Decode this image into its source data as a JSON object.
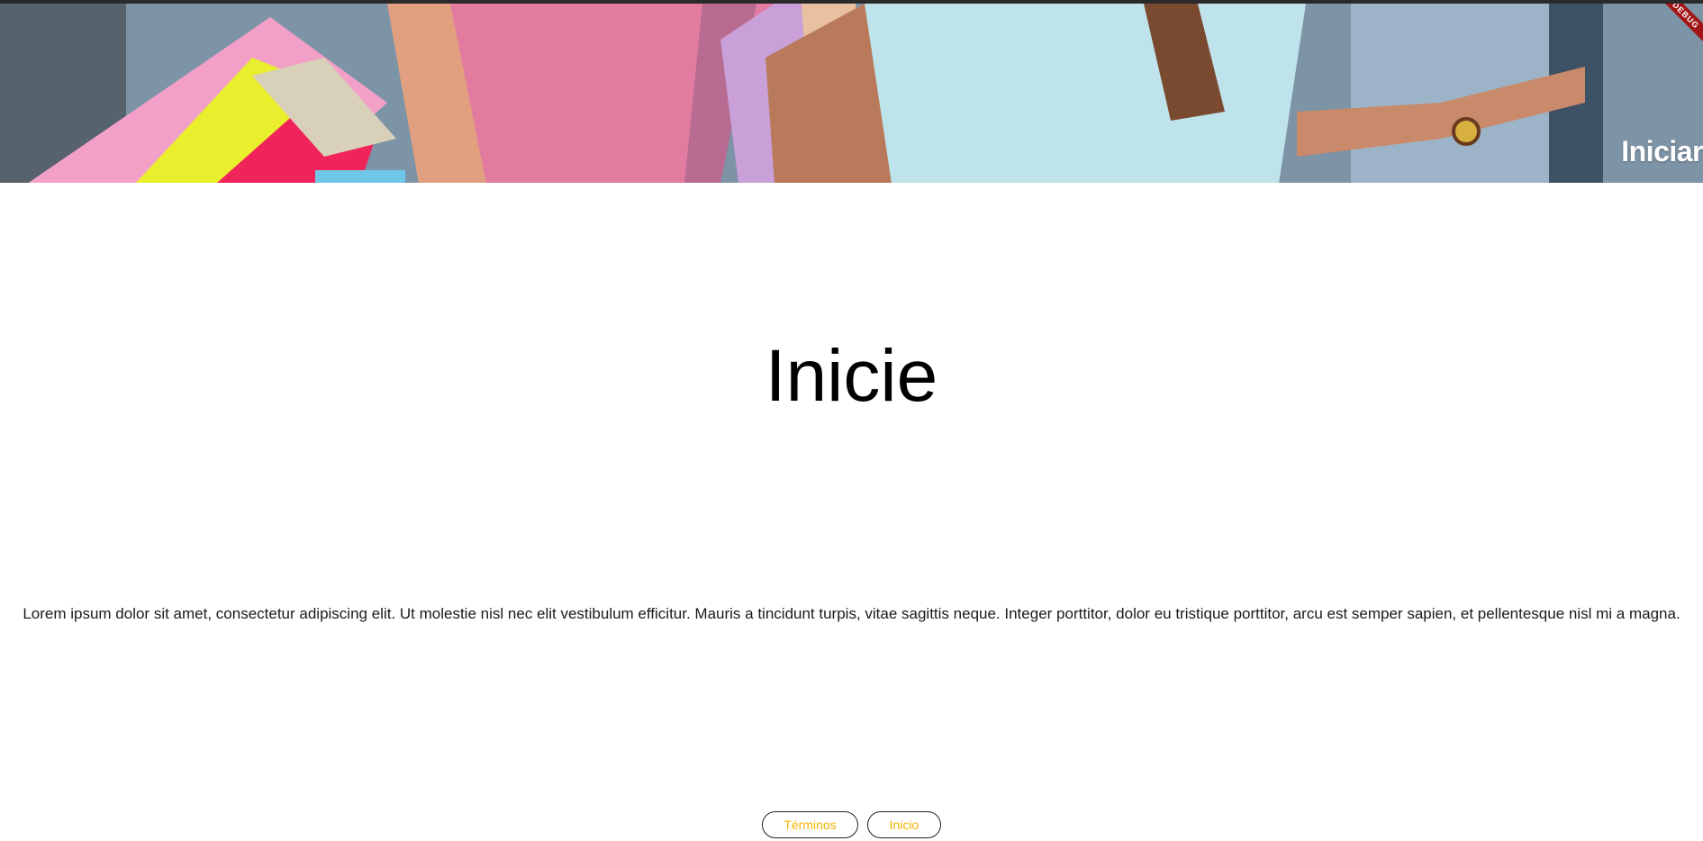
{
  "hero": {
    "title": "Iniciar",
    "debug_label": "DEBUG"
  },
  "main": {
    "heading": "Inicie",
    "body": "Lorem ipsum dolor sit amet, consectetur adipiscing elit. Ut molestie nisl nec elit vestibulum efficitur. Mauris a tincidunt turpis, vitae sagittis neque. Integer porttitor, dolor eu tristique porttitor, arcu est semper sapien, et pellentesque nisl mi a magna."
  },
  "footer": {
    "terminos_label": "Términos",
    "inicio_label": "Inicio"
  },
  "colors": {
    "button_text": "#f0b400",
    "debug_ribbon": "#a31515"
  }
}
